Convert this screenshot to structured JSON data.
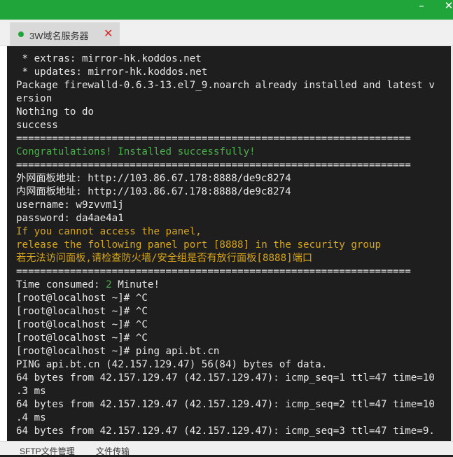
{
  "window": {
    "minimize_glyph": "–",
    "close_glyph": "✕"
  },
  "tab": {
    "label": "3W域名服务器",
    "close_glyph": "✕",
    "status_color": "#20a53a"
  },
  "terminal": {
    "lines": [
      {
        "text": " * extras: mirror-hk.koddos.net",
        "color": "default"
      },
      {
        "text": " * updates: mirror-hk.koddos.net",
        "color": "default"
      },
      {
        "text": "Package firewalld-0.6.3-13.el7_9.noarch already installed and latest v",
        "color": "default"
      },
      {
        "text": "ersion",
        "color": "default"
      },
      {
        "text": "Nothing to do",
        "color": "default"
      },
      {
        "text": "success",
        "color": "default"
      },
      {
        "text": "==================================================================",
        "color": "default"
      },
      {
        "text": "Congratulations! Installed successfully!",
        "color": "green"
      },
      {
        "text": "==================================================================",
        "color": "default"
      },
      {
        "text": "外网面板地址: http://103.86.67.178:8888/de9c8274",
        "color": "default"
      },
      {
        "text": "内网面板地址: http://103.86.67.178:8888/de9c8274",
        "color": "default"
      },
      {
        "text": "username: w9zvvm1j",
        "color": "default"
      },
      {
        "text": "password: da4ae4a1",
        "color": "default"
      },
      {
        "text": "If you cannot access the panel,",
        "color": "yellow"
      },
      {
        "text": "release the following panel port [8888] in the security group",
        "color": "yellow"
      },
      {
        "text": "若无法访问面板,请检查防火墙/安全组是否有放行面板[8888]端口",
        "color": "yellow"
      },
      {
        "text": "==================================================================",
        "color": "default"
      },
      {
        "text": "Time consumed: ",
        "color": "default",
        "suffix_green": "2",
        "suffix": " Minute!"
      },
      {
        "text": "[root@localhost ~]# ^C",
        "color": "default"
      },
      {
        "text": "[root@localhost ~]# ^C",
        "color": "default"
      },
      {
        "text": "[root@localhost ~]# ^C",
        "color": "default"
      },
      {
        "text": "[root@localhost ~]# ^C",
        "color": "default"
      },
      {
        "text": "[root@localhost ~]# ping api.bt.cn",
        "color": "default"
      },
      {
        "text": "PING api.bt.cn (42.157.129.47) 56(84) bytes of data.",
        "color": "default"
      },
      {
        "text": "64 bytes from 42.157.129.47 (42.157.129.47): icmp_seq=1 ttl=47 time=10",
        "color": "default"
      },
      {
        "text": ".3 ms",
        "color": "default"
      },
      {
        "text": "64 bytes from 42.157.129.47 (42.157.129.47): icmp_seq=2 ttl=47 time=10",
        "color": "default"
      },
      {
        "text": ".4 ms",
        "color": "default"
      },
      {
        "text": "64 bytes from 42.157.129.47 (42.157.129.47): icmp_seq=3 ttl=47 time=9.",
        "color": "default"
      }
    ]
  },
  "bottom_tabs": [
    {
      "label": "SFTP文件管理"
    },
    {
      "label": "文件传输"
    }
  ],
  "colors": {
    "accent": "#20a53a",
    "terminal_bg": "#1e1e1e",
    "success_text": "#4cae4c",
    "warning_text": "#d6a51a"
  }
}
